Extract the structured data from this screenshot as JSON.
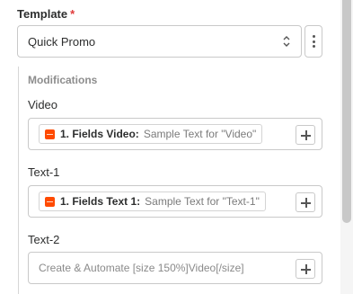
{
  "template": {
    "label": "Template",
    "required_mark": "*",
    "selected": "Quick Promo"
  },
  "modifications": {
    "label": "Modifications",
    "fields": [
      {
        "label": "Video",
        "token_key": "1. Fields Video:",
        "token_value": "Sample Text for \"Video\""
      },
      {
        "label": "Text-1",
        "token_key": "1. Fields Text 1:",
        "token_value": "Sample Text for \"Text-1\""
      },
      {
        "label": "Text-2",
        "value": "Create & Automate [size 150%]Video[/size]"
      }
    ]
  },
  "colors": {
    "required": "#e03b3b",
    "app_logo": "#ff4a00"
  },
  "icons": [
    "chevron-up-down-icon",
    "kebab-menu-icon",
    "app-logo-icon",
    "plus-icon"
  ]
}
